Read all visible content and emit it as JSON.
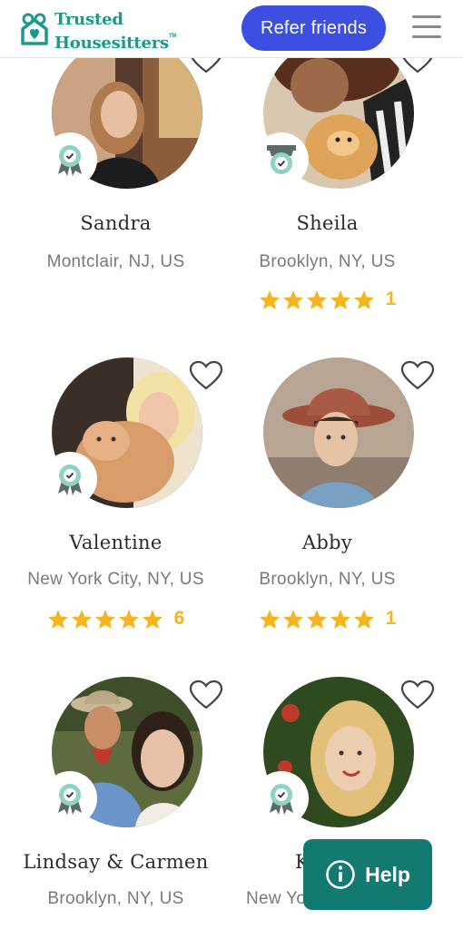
{
  "header": {
    "logo_line1": "Trusted",
    "logo_line2": "Housesitters",
    "logo_tm": "TM",
    "refer_button": "Refer friends",
    "menu_icon": "hamburger-menu-icon"
  },
  "colors": {
    "brand_teal": "#1a9a8c",
    "refer_blue": "#3d4fe0",
    "star_gold": "#f5b51f",
    "help_green": "#137a72"
  },
  "sitters": [
    {
      "name": "Sandra",
      "location": "Montclair, NJ, US",
      "badge": "verified-ribbon-icon",
      "rating": null,
      "reviews": null
    },
    {
      "name": "Sheila",
      "location": "Brooklyn, NY, US",
      "badge": "verified-ribbon-icon",
      "rating": 5,
      "reviews": "1"
    },
    {
      "name": "Valentine",
      "location": "New York City, NY, US",
      "badge": "verified-ribbon-icon",
      "rating": 5,
      "reviews": "6"
    },
    {
      "name": "Abby",
      "location": "Brooklyn, NY, US",
      "badge": null,
      "rating": 5,
      "reviews": "1"
    },
    {
      "name": "Lindsay & Carmen",
      "location": "Brooklyn, NY, US",
      "badge": "verified-ribbon-icon",
      "rating": null,
      "reviews": null
    },
    {
      "name": "K",
      "location": "New Yo",
      "badge": "verified-ribbon-icon",
      "rating": null,
      "reviews": null
    }
  ],
  "help_button": {
    "label": "Help",
    "icon": "info-icon"
  }
}
